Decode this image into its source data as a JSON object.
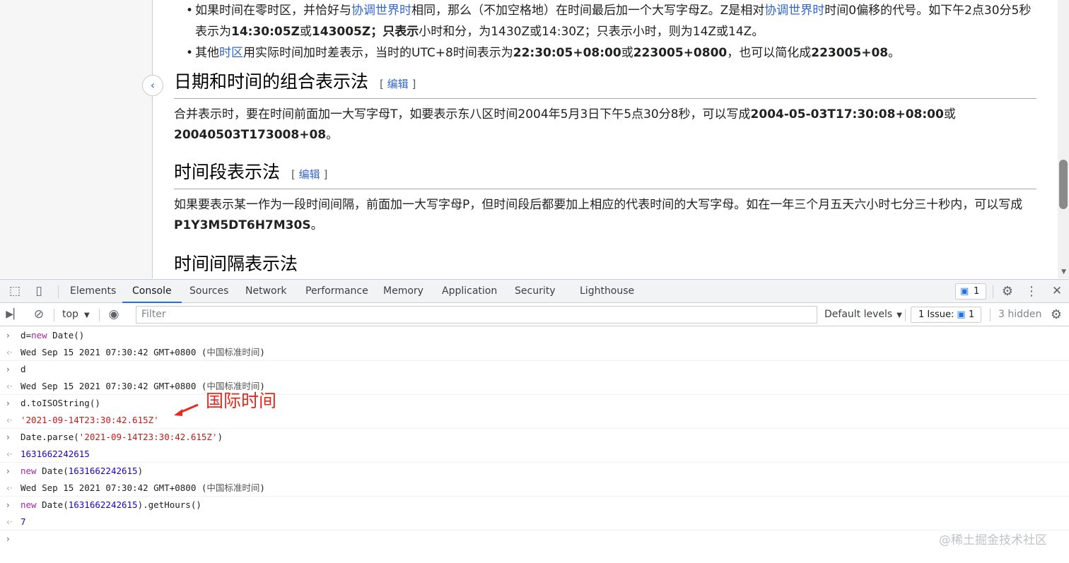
{
  "wiki": {
    "bullet1": {
      "pre": "如果时间在零时区，并恰好与",
      "link1": "协调世界时",
      "mid": "相同，那么（不加空格地）在时间最后加一个大写字母Z。Z是相对",
      "link2": "协调世界时",
      "post": "时间0偏移的代号。如下午2点30分5秒表示为",
      "b1": "14:30:05Z",
      "or1": "或",
      "b2": "143005Z",
      "semi": "；",
      "b3": "只表示",
      "tail": "小时和分，为1430Z或14:30Z；只表示小时，则为14Z或14Z。"
    },
    "bullet2": {
      "pre": "其他",
      "link": "时区",
      "mid": "用实际时间加时差表示，当时的UTC+8时间表示为",
      "b1": "22:30:05+08:00",
      "or1": "或",
      "b2": "223005+0800",
      "mid2": "，也可以简化成",
      "b3": "223005+08",
      "end": "。"
    },
    "section1": {
      "title": "日期和时间的组合表示法",
      "edit_open": "[",
      "edit": "编辑",
      "edit_close": "]",
      "para_pre": "合并表示时，要在时间前面加一大写字母T，如要表示东八区时间2004年5月3日下午5点30分8秒，可以写成",
      "b1": "2004-05-03T17:30:08+08:00",
      "or1": "或",
      "b2": "20040503T173008+08",
      "end": "。"
    },
    "section2": {
      "title": "时间段表示法",
      "edit_open": "[",
      "edit": "编辑",
      "edit_close": "]",
      "para_pre": "如果要表示某一作为一段时间间隔，前面加一大写字母P，但时间段后都要加上相应的代表时间的大写字母。如在一年三个月五天六小时七分三十秒内，可以写成",
      "b1": "P1Y3M5DT6H7M30S",
      "end": "。"
    },
    "section3": {
      "title": "时间间隔表示法"
    },
    "collapse_icon": "chevron-left-icon"
  },
  "devtools": {
    "tabs": [
      "Elements",
      "Console",
      "Sources",
      "Network",
      "Performance",
      "Memory",
      "Application",
      "Security",
      "Lighthouse"
    ],
    "active_tab": "Console",
    "messages_count": "1",
    "toolbar": {
      "context": "top",
      "filter_placeholder": "Filter",
      "levels": "Default levels",
      "issues_label": "1 Issue:",
      "issues_count": "1",
      "hidden": "3 hidden"
    },
    "accent": "#1a73e8"
  },
  "console": {
    "rows": [
      {
        "kind": "in",
        "parts": [
          [
            "plain",
            "d="
          ],
          [
            "kw",
            "new"
          ],
          [
            "plain",
            " Date()"
          ]
        ]
      },
      {
        "kind": "out",
        "parts": [
          [
            "plain",
            "Wed Sep 15 2021 07:30:42 GMT+0800 ("
          ],
          [
            "cjk",
            "中国标准时间"
          ],
          [
            "plain",
            ")"
          ]
        ]
      },
      {
        "kind": "in",
        "parts": [
          [
            "plain",
            "d"
          ]
        ]
      },
      {
        "kind": "out",
        "parts": [
          [
            "plain",
            "Wed Sep 15 2021 07:30:42 GMT+0800 ("
          ],
          [
            "cjk",
            "中国标准时间"
          ],
          [
            "plain",
            ")"
          ]
        ]
      },
      {
        "kind": "in",
        "parts": [
          [
            "plain",
            "d.toISOString()"
          ]
        ]
      },
      {
        "kind": "out",
        "parts": [
          [
            "str",
            "'2021-09-14T23:30:42.615Z'"
          ]
        ]
      },
      {
        "kind": "in",
        "parts": [
          [
            "plain",
            "Date.parse("
          ],
          [
            "str",
            "'2021-09-14T23:30:42.615Z'"
          ],
          [
            "plain",
            ")"
          ]
        ]
      },
      {
        "kind": "out",
        "parts": [
          [
            "num",
            "1631662242615"
          ]
        ]
      },
      {
        "kind": "in",
        "parts": [
          [
            "kw",
            "new"
          ],
          [
            "plain",
            " Date("
          ],
          [
            "num",
            "1631662242615"
          ],
          [
            "plain",
            ")"
          ]
        ]
      },
      {
        "kind": "out",
        "parts": [
          [
            "plain",
            "Wed Sep 15 2021 07:30:42 GMT+0800 ("
          ],
          [
            "cjk",
            "中国标准时间"
          ],
          [
            "plain",
            ")"
          ]
        ]
      },
      {
        "kind": "in",
        "parts": [
          [
            "kw",
            "new"
          ],
          [
            "plain",
            " Date("
          ],
          [
            "num",
            "1631662242615"
          ],
          [
            "plain",
            ").getHours()"
          ]
        ]
      },
      {
        "kind": "out",
        "parts": [
          [
            "num",
            "7"
          ]
        ]
      }
    ],
    "annotation": "国际时间",
    "annotation_color": "#e8281e",
    "watermark": "@稀土掘金技术社区"
  }
}
